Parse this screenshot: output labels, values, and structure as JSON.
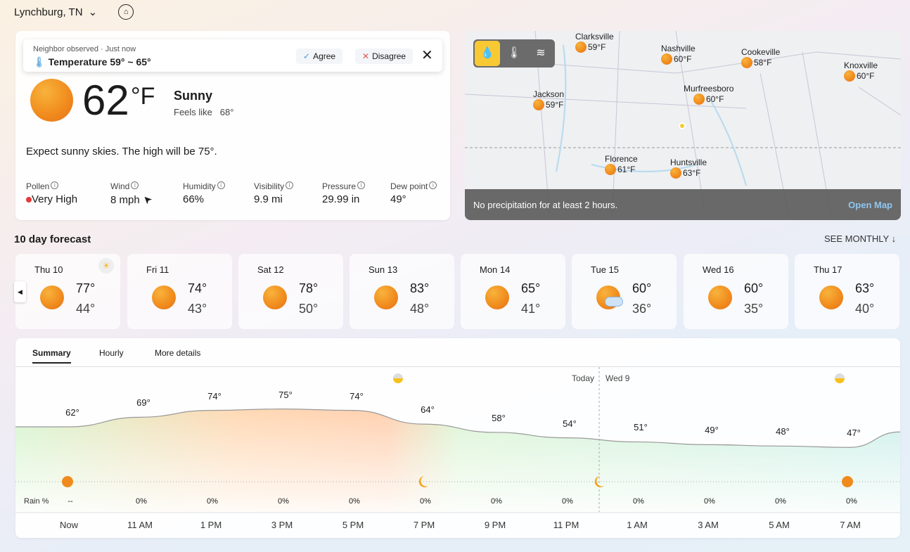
{
  "location": {
    "name": "Lynchburg, TN",
    "home_icon": "home-icon"
  },
  "toast": {
    "source": "Neighbor observed · Just now",
    "text": "Temperature 59° ~ 65°",
    "agree": "Agree",
    "disagree": "Disagree"
  },
  "current": {
    "temp": "62",
    "unit": "°F",
    "condition": "Sunny",
    "feels_label": "Feels like",
    "feels": "68°",
    "summary": "Expect sunny skies. The high will be 75°.",
    "metrics": [
      {
        "label": "Pollen",
        "value": "Very High"
      },
      {
        "label": "Wind",
        "value": "8 mph"
      },
      {
        "label": "Humidity",
        "value": "66%"
      },
      {
        "label": "Visibility",
        "value": "9.9 mi"
      },
      {
        "label": "Pressure",
        "value": "29.99 in"
      },
      {
        "label": "Dew point",
        "value": "49°"
      }
    ],
    "pollen_color": "#e23b3b"
  },
  "map": {
    "cities": [
      {
        "name": "Clarksville",
        "temp": "59°F"
      },
      {
        "name": "Nashville",
        "temp": "60°F"
      },
      {
        "name": "Cookeville",
        "temp": "58°F"
      },
      {
        "name": "Knoxville",
        "temp": "60°F"
      },
      {
        "name": "Jackson",
        "temp": "59°F"
      },
      {
        "name": "Murfreesboro",
        "temp": "60°F"
      },
      {
        "name": "Florence",
        "temp": "61°F"
      },
      {
        "name": "Huntsville",
        "temp": "63°F"
      }
    ],
    "status": "No precipitation for at least 2 hours.",
    "open": "Open Map",
    "active_layer": "precipitation",
    "accent": "#f9c934"
  },
  "forecast": {
    "title": "10 day forecast",
    "see_monthly": "SEE MONTHLY",
    "days": [
      {
        "day": "Thu 10",
        "hi": "77°",
        "lo": "44°"
      },
      {
        "day": "Fri 11",
        "hi": "74°",
        "lo": "43°"
      },
      {
        "day": "Sat 12",
        "hi": "78°",
        "lo": "50°"
      },
      {
        "day": "Sun 13",
        "hi": "83°",
        "lo": "48°"
      },
      {
        "day": "Mon 14",
        "hi": "65°",
        "lo": "41°"
      },
      {
        "day": "Tue 15",
        "hi": "60°",
        "lo": "36°",
        "icon": "partly-cloudy"
      },
      {
        "day": "Wed 16",
        "hi": "60°",
        "lo": "35°"
      },
      {
        "day": "Thu 17",
        "hi": "63°",
        "lo": "40°"
      }
    ]
  },
  "tabs": [
    "Summary",
    "Hourly",
    "More details"
  ],
  "hourly": {
    "today": "Today",
    "next_day": "Wed 9",
    "rain_label": "Rain %",
    "times": [
      "Now",
      "11 AM",
      "1 PM",
      "3 PM",
      "5 PM",
      "7 PM",
      "9 PM",
      "11 PM",
      "1 AM",
      "3 AM",
      "5 AM",
      "7 AM"
    ],
    "temps": [
      62,
      69,
      74,
      75,
      74,
      64,
      58,
      54,
      51,
      49,
      48,
      47
    ],
    "temp_labels": [
      "62°",
      "69°",
      "74°",
      "75°",
      "74°",
      "64°",
      "58°",
      "54°",
      "51°",
      "49°",
      "48°",
      "47°"
    ],
    "rain": [
      "--",
      "0%",
      "0%",
      "0%",
      "0%",
      "0%",
      "0%",
      "0%",
      "0%",
      "0%",
      "0%",
      "0%"
    ]
  }
}
